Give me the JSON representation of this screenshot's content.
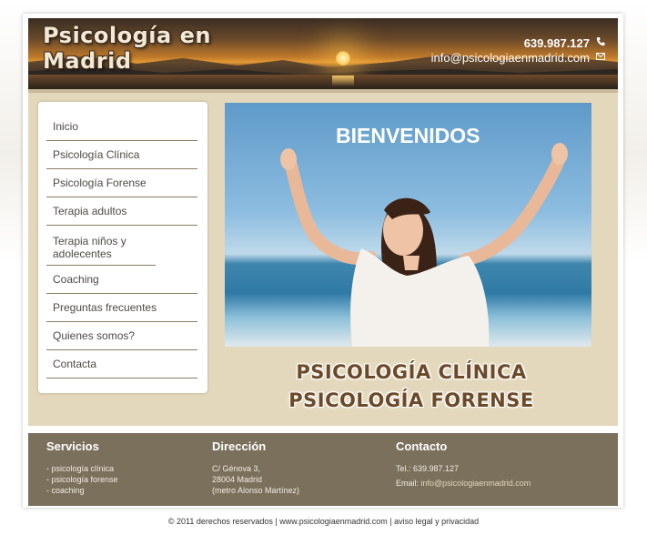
{
  "header": {
    "brand_line1": "Psicología en",
    "brand_line2": "Madrid",
    "phone": "639.987.127",
    "email": "info@psicologiaenmadrid.com",
    "phone_icon": "phone-icon",
    "email_icon": "envelope-icon"
  },
  "menu": {
    "items": [
      "Inicio",
      "Psicología Clínica",
      "Psicología Forense",
      "Terapia adultos",
      "Terapia niños y adolecentes",
      "Coaching",
      "Preguntas frecuentes",
      "Quienes somos?",
      "Contacta"
    ]
  },
  "hero": {
    "title": "BIENVENIDOS"
  },
  "tagline": {
    "line1": "PSICOLOGÍA CLÍNICA",
    "line2": "PSICOLOGÍA FORENSE"
  },
  "footer": {
    "servicios": {
      "title": "Servicios",
      "items": [
        "- psicología clínica",
        "- psicología forense",
        "- coaching"
      ]
    },
    "direccion": {
      "title": "Dirección",
      "lines": [
        "C/ Génova 3,",
        "28004 Madrid",
        "(metro Alonso Martínez)"
      ]
    },
    "contacto": {
      "title": "Contacto",
      "tel": "Tel.: 639.987.127",
      "email_label": "Email:",
      "email": "info@psicologiaenmadrid.com"
    }
  },
  "copyright": "© 2011 derechos reservados | www.psicologiaenmadrid.com | aviso legal y privacidad",
  "colors": {
    "brand_brown": "#6b4a2a",
    "panel_beige": "#e3d8bb",
    "footer_bg": "#7b705c"
  }
}
